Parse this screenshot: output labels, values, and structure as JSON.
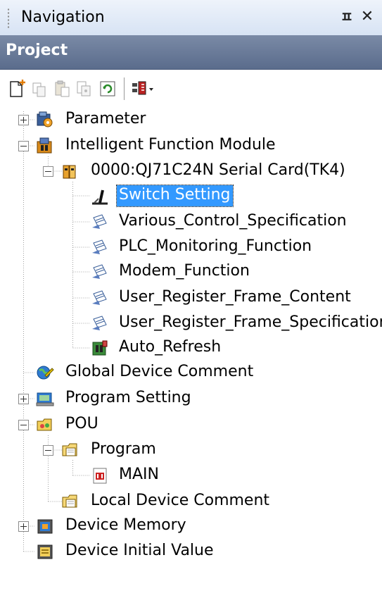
{
  "panel": {
    "title": "Navigation",
    "pin_glyph": "ㅍ",
    "close_glyph": "✕",
    "section_title": "Project"
  },
  "toolbar": {
    "buttons": [
      {
        "icon": "new-data-icon"
      },
      {
        "icon": "copy-icon"
      },
      {
        "icon": "paste-icon"
      },
      {
        "icon": "properties-icon"
      },
      {
        "icon": "refresh-icon"
      },
      {
        "icon": "display-settings-dropdown-icon"
      }
    ]
  },
  "tree": {
    "parameter": "Parameter",
    "intelligent_function_module": "Intelligent Function Module",
    "module": "0000:QJ71C24N  Serial Card(TK4)",
    "switch_setting": "Switch Setting",
    "various_control": "Various_Control_Specification",
    "plc_monitoring": "PLC_Monitoring_Function",
    "modem_function": "Modem_Function",
    "user_register_content": "User_Register_Frame_Content",
    "user_register_spec": "User_Register_Frame_Specification",
    "auto_refresh": "Auto_Refresh",
    "global_device_comment": "Global Device Comment",
    "program_setting": "Program Setting",
    "pou": "POU",
    "program": "Program",
    "main": "MAIN",
    "local_device_comment": "Local Device Comment",
    "device_memory": "Device Memory",
    "device_initial_value": "Device Initial Value",
    "selected": "Switch Setting"
  },
  "colors": {
    "selection": "#3399ff",
    "project_header": "#5a6c8c",
    "titlebar": "#d7e3f4"
  }
}
